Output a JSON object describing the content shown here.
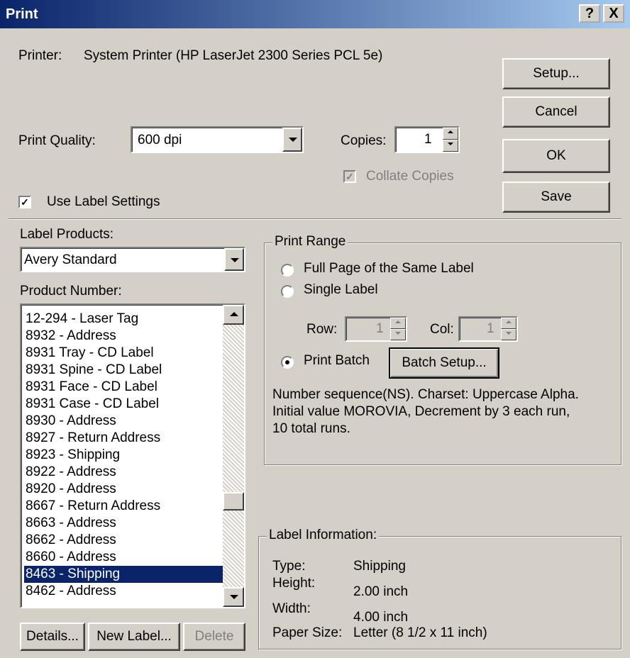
{
  "window": {
    "title": "Print"
  },
  "titlebar_buttons": {
    "help": "?",
    "close": "X"
  },
  "printer": {
    "label": "Printer:",
    "value": "System Printer (HP LaserJet 2300 Series PCL 5e)"
  },
  "buttons": {
    "setup": "Setup...",
    "cancel": "Cancel",
    "ok": "OK",
    "save": "Save",
    "batch_setup": "Batch Setup...",
    "details": "Details...",
    "new_label": "New Label...",
    "delete": "Delete"
  },
  "print_quality": {
    "label": "Print Quality:",
    "value": "600 dpi"
  },
  "copies": {
    "label": "Copies:",
    "value": "1",
    "collate_label": "Collate Copies",
    "collate_checked": true
  },
  "use_label_settings": {
    "label": "Use Label Settings",
    "checked": true
  },
  "label_products": {
    "label": "Label Products:",
    "value": "Avery Standard"
  },
  "product_number": {
    "label": "Product Number:",
    "items": [
      "12-294 - Laser Tag",
      "8932 - Address",
      "8931 Tray - CD Label",
      "8931 Spine - CD Label",
      "8931 Face - CD Label",
      "8931 Case - CD Label",
      "8930 - Address",
      "8927 - Return Address",
      "8923 - Shipping",
      "8922 - Address",
      "8920 - Address",
      "8667 - Return Address",
      "8663 - Address",
      "8662 - Address",
      "8660 - Address",
      "8463 - Shipping",
      "8462 - Address"
    ],
    "selected": "8463 - Shipping"
  },
  "print_range": {
    "legend": "Print Range",
    "full_page": "Full Page of the Same Label",
    "single_label": "Single Label",
    "row_label": "Row:",
    "row_value": "1",
    "col_label": "Col:",
    "col_value": "1",
    "print_batch": "Print Batch",
    "selected": "Print Batch",
    "batch_description": [
      "Number sequence(NS). Charset: Uppercase Alpha.",
      "Initial value MOROVIA, Decrement by 3 each run,",
      "10 total runs."
    ]
  },
  "label_information": {
    "legend": "Label Information:",
    "type_label": "Type:",
    "type_value": "Shipping",
    "height_label": "Height:",
    "height_value": "2.00 inch",
    "width_label": "Width:",
    "width_value": "4.00 inch",
    "paper_label": "Paper Size:",
    "paper_value": "Letter (8 1/2 x 11 inch)"
  }
}
